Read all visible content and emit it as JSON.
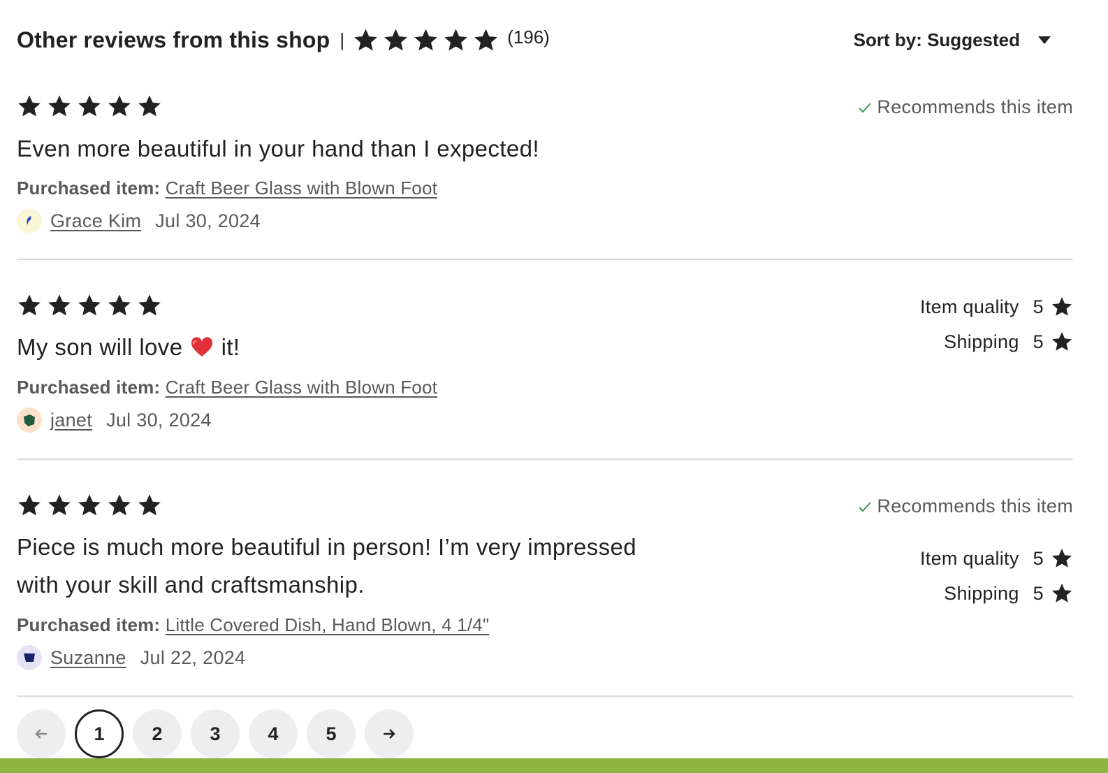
{
  "header": {
    "title": "Other reviews from this shop",
    "separator": "|",
    "rating_stars": 5,
    "review_count": "(196)",
    "sort_label": "Sort by: Suggested"
  },
  "reviews": [
    {
      "stars": 5,
      "text": "Even more beautiful in your hand than I expected!",
      "purchased_label": "Purchased item:",
      "item": "Craft Beer Glass with Blown Foot",
      "reviewer": "Grace Kim",
      "date": "Jul 30, 2024",
      "recommends": "Recommends this item"
    },
    {
      "stars": 5,
      "text_before": "My son will love",
      "text_after": "it!",
      "purchased_label": "Purchased item:",
      "item": "Craft Beer Glass with Blown Foot",
      "reviewer": "janet",
      "date": "Jul 30, 2024",
      "item_quality_label": "Item quality",
      "item_quality_value": "5",
      "shipping_label": "Shipping",
      "shipping_value": "5"
    },
    {
      "stars": 5,
      "text_line1": "Piece is much more beautiful in person! I’m very impressed",
      "text_line2": "with your skill and craftsmanship.",
      "purchased_label": "Purchased item:",
      "item": "Little Covered Dish, Hand Blown, 4 1/4\"",
      "reviewer": "Suzanne",
      "date": "Jul 22, 2024",
      "recommends": "Recommends this item",
      "item_quality_label": "Item quality",
      "item_quality_value": "5",
      "shipping_label": "Shipping",
      "shipping_value": "5"
    }
  ],
  "pagination": {
    "pages": [
      "1",
      "2",
      "3",
      "4",
      "5"
    ],
    "current": "1"
  },
  "colors": {
    "text": "#222222",
    "muted": "#595959",
    "check": "#3d9a4e",
    "divider": "#dadada",
    "page_button_bg": "#eeeeee",
    "bottom_bar": "#8db342"
  },
  "icons": [
    "star-icon",
    "chevron-down-icon",
    "check-icon",
    "heart-emoji-icon",
    "arrow-left-icon",
    "arrow-right-icon"
  ]
}
